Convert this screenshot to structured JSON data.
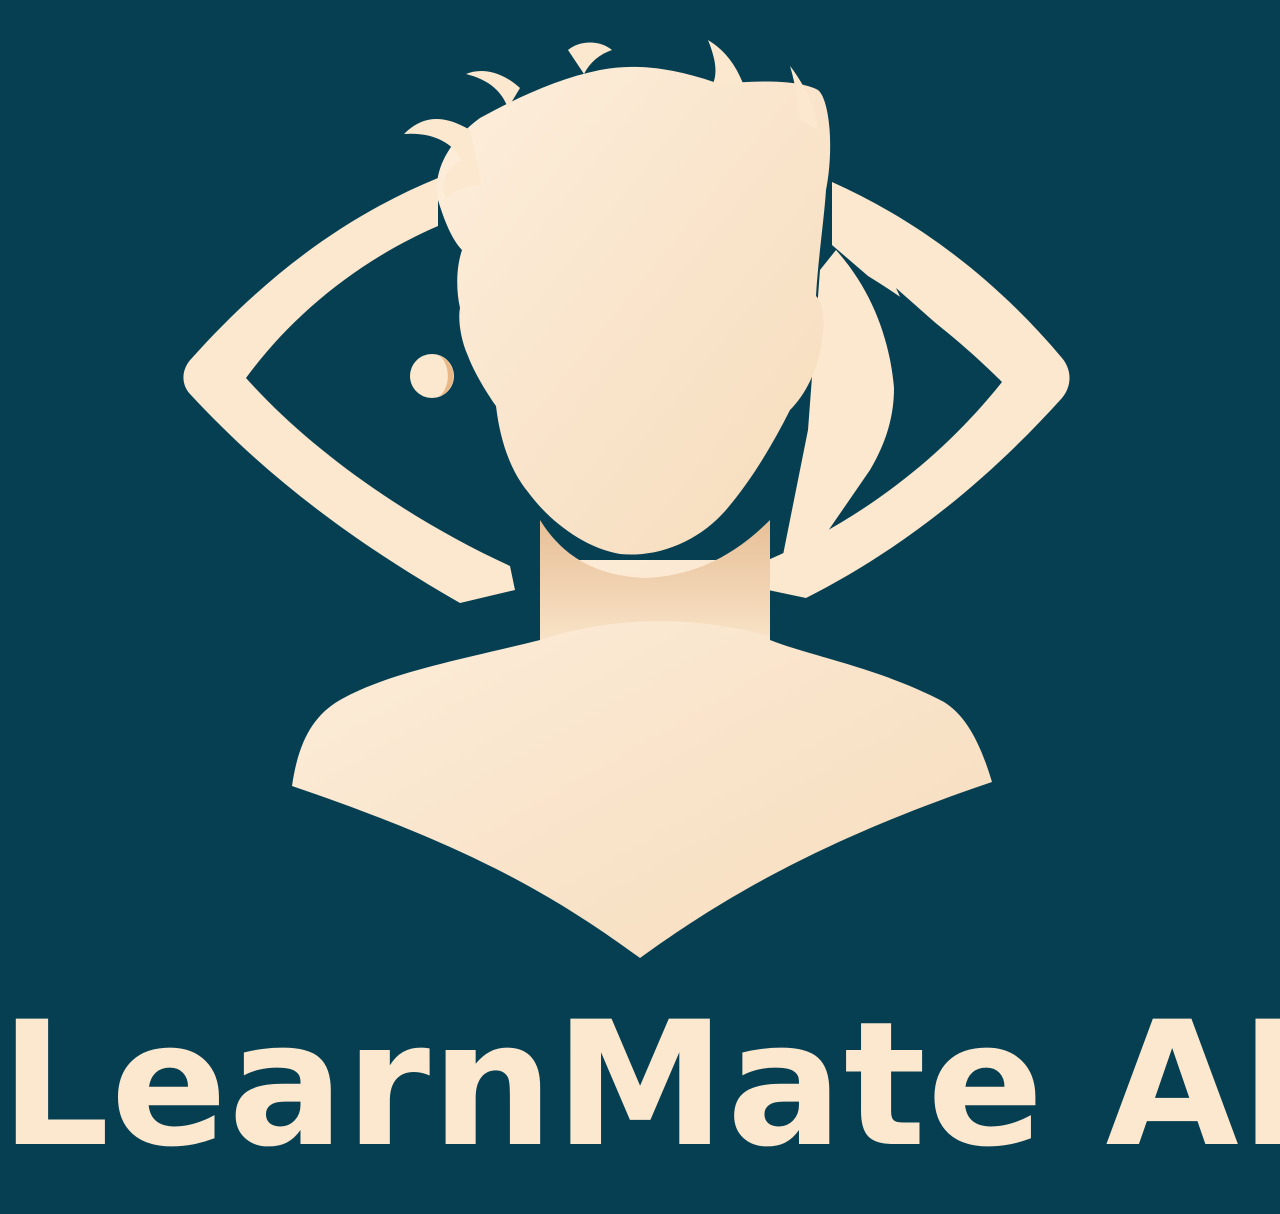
{
  "brand": {
    "name": "LearnMate AI"
  },
  "colors": {
    "background": "#063f52",
    "cream": "#fbe8cf",
    "cream_shadow": "#ecc8a0",
    "dot_accent": "#e9b886"
  },
  "icons": {
    "logo": "person-bust-with-eye-arcs-icon"
  }
}
